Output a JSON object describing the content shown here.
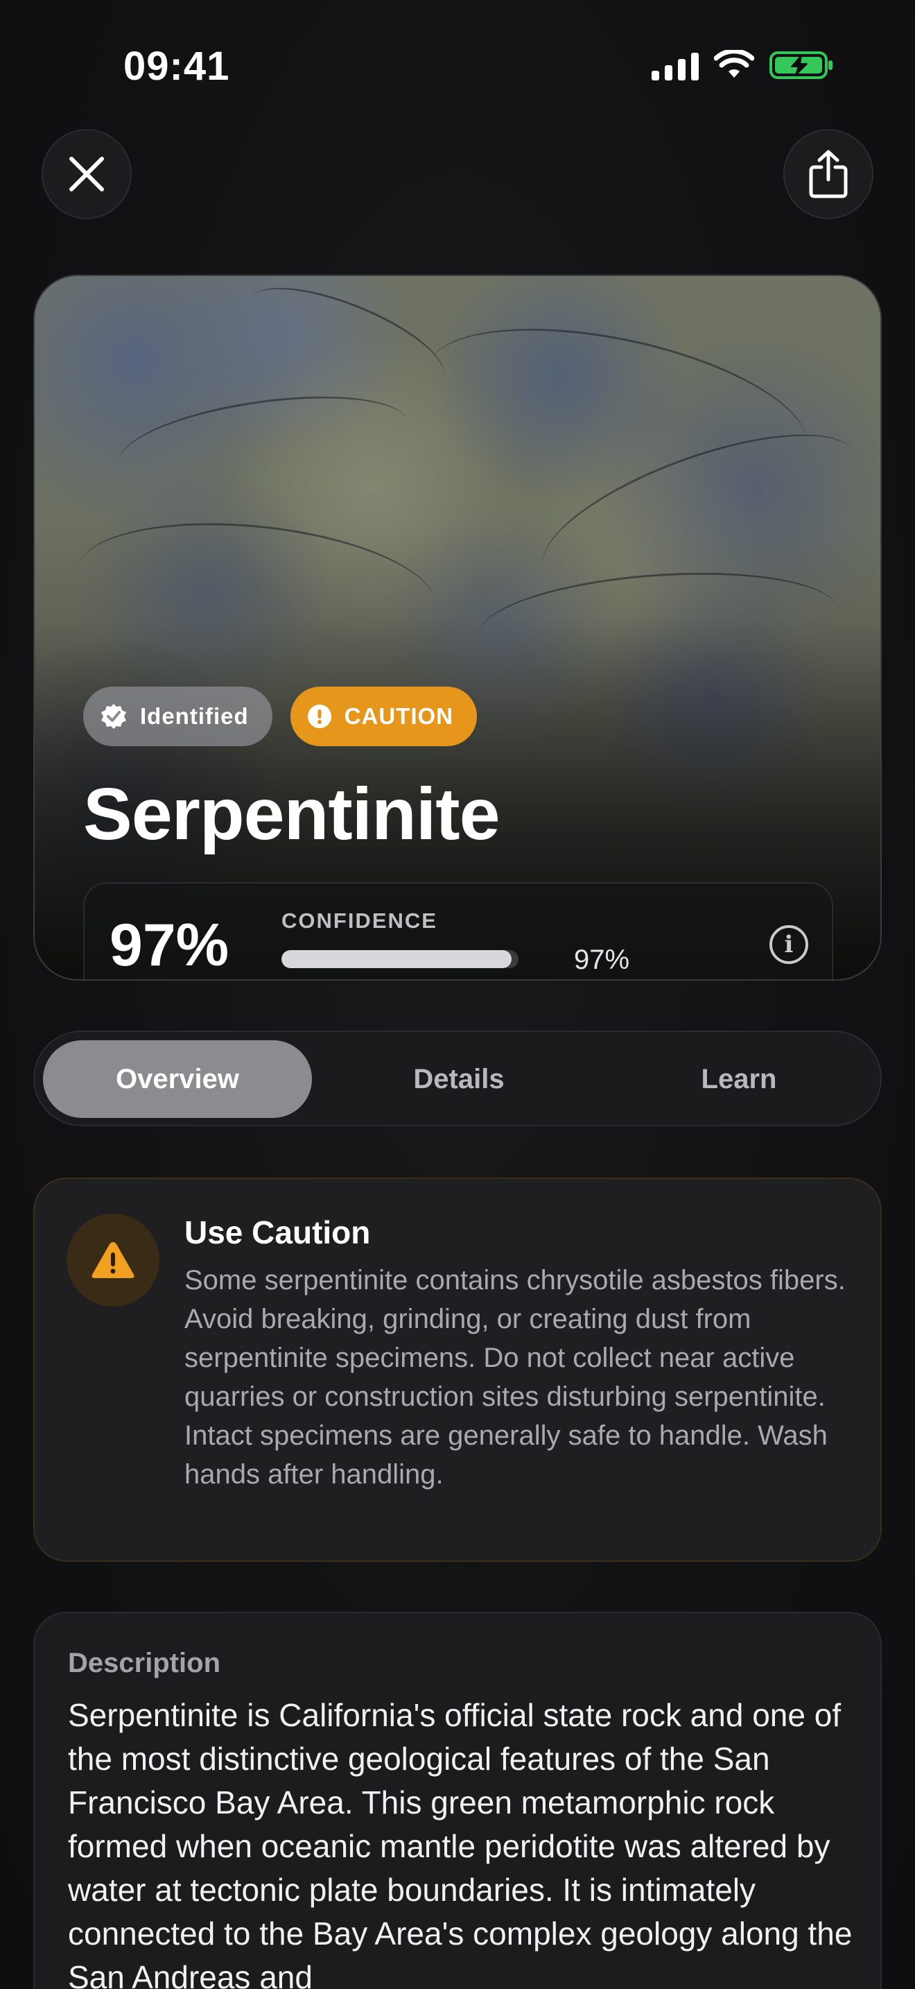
{
  "status_bar": {
    "time": "09:41",
    "icons": [
      "cellular-signal-icon",
      "wifi-icon",
      "battery-charging-icon"
    ],
    "battery_color": "#34c759"
  },
  "header": {
    "close_icon": "close-icon",
    "share_icon": "share-icon"
  },
  "hero": {
    "badges": [
      {
        "label": "Identified",
        "icon": "verified-check-icon"
      },
      {
        "label": "CAUTION",
        "icon": "exclamation-icon",
        "color": "#e7961c"
      }
    ],
    "title": "Serpentinite",
    "confidence": {
      "value_big": "97%",
      "label": "CONFIDENCE",
      "value_small": "97%",
      "fraction": 0.97,
      "info_icon": "info-icon"
    }
  },
  "tabs": {
    "items": [
      {
        "label": "Overview"
      },
      {
        "label": "Details"
      },
      {
        "label": "Learn"
      }
    ],
    "selected": "Overview"
  },
  "caution": {
    "icon": "warning-triangle-icon",
    "title": "Use Caution",
    "body": "Some serpentinite contains chrysotile asbestos fibers. Avoid breaking, grinding, or creating dust from serpentinite specimens. Do not collect near active quarries or construction sites disturbing serpentinite. Intact specimens are generally safe to handle. Wash hands after handling."
  },
  "description": {
    "label": "Description",
    "body": "Serpentinite is California's official state rock and one of the most distinctive geological features of the San Francisco Bay Area. This green metamorphic rock formed when oceanic mantle peridotite was altered by water at tectonic plate boundaries. It is intimately connected to the Bay Area's complex geology along the San Andreas and"
  }
}
